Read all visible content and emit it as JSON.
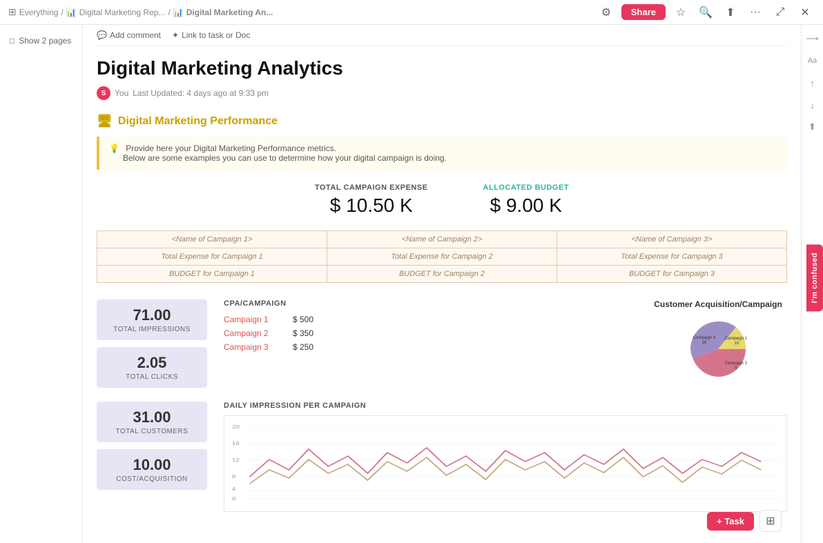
{
  "topbar": {
    "breadcrumbs": [
      {
        "label": "Everything",
        "icon": "grid-icon"
      },
      {
        "label": "Digital Marketing Rep...",
        "icon": "chart-icon"
      },
      {
        "label": "Digital Marketing An...",
        "icon": "chart-icon"
      }
    ],
    "share_label": "Share"
  },
  "sidebar": {
    "show_pages_label": "Show 2 pages"
  },
  "toolbar": {
    "add_comment_label": "Add comment",
    "link_label": "Link to task or Doc"
  },
  "page": {
    "title": "Digital Marketing Analytics",
    "author": "You",
    "last_updated": "Last Updated: 4 days ago at 9:33 pm"
  },
  "section": {
    "heading": "Digital Marketing Performance",
    "info_line1": "Provide here your Digital Marketing Performance metrics.",
    "info_line2": "Below are some examples you can use to determine how your digital campaign is doing."
  },
  "stats": {
    "total_expense_label": "TOTAL CAMPAIGN EXPENSE",
    "total_expense_value": "$ 10.50 K",
    "allocated_budget_label": "ALLOCATED BUDGET",
    "allocated_budget_value": "$ 9.00 K"
  },
  "campaign_table": {
    "rows": [
      [
        "<Name of Campaign 1>",
        "<Name of Campaign 2>",
        "<Name of Campaign 3>"
      ],
      [
        "Total Expense for Campaign 1",
        "Total Expense for Campaign 2",
        "Total Expense for Campaign 3"
      ],
      [
        "BUDGET for Campaign 1",
        "BUDGET for Campaign 2",
        "BUDGET for Campaign 3"
      ]
    ]
  },
  "metrics": {
    "impressions_value": "71.00",
    "impressions_label": "TOTAL IMPRESSIONS",
    "clicks_value": "2.05",
    "clicks_label": "TOTAL CLICKS",
    "customers_value": "31.00",
    "customers_label": "TOTAL CUSTOMERS",
    "cost_value": "10.00",
    "cost_label": "COST/ACQUISITION"
  },
  "cpa": {
    "title": "CPA/CAMPAIGN",
    "campaigns": [
      {
        "name": "Campaign 1",
        "value": "$ 500"
      },
      {
        "name": "Campaign 2",
        "value": "$ 350"
      },
      {
        "name": "Campaign 3",
        "value": "$ 250"
      }
    ]
  },
  "pie_chart": {
    "title": "Customer Acquisition/Campaign",
    "segments": [
      {
        "label": "Campaign 1",
        "value": 10,
        "color": "#d4748c"
      },
      {
        "label": "Campaign 2",
        "value": 5,
        "color": "#e8d8a0"
      },
      {
        "label": "Campaign 3",
        "value": 16,
        "color": "#9b8ec4"
      }
    ]
  },
  "daily_chart": {
    "title": "DAILY IMPRESSION PER CAMPAIGN"
  },
  "bottom_toolbar": {
    "task_label": "+ Task"
  },
  "confused_btn": {
    "label": "I'm confused"
  }
}
